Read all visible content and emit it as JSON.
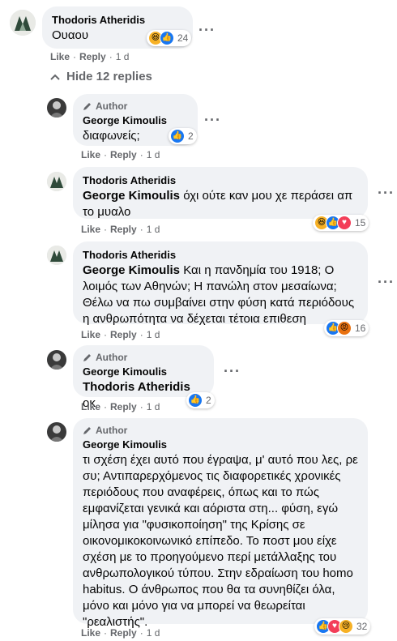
{
  "top_comment": {
    "author": "Thodoris Atheridis",
    "text": "Ουαου",
    "reactions": {
      "icons": [
        "haha",
        "like"
      ],
      "count": "24"
    },
    "actions": {
      "like": "Like",
      "reply": "Reply",
      "time": "1 d"
    }
  },
  "hide_replies": "Hide 12 replies",
  "author_badge": "Author",
  "replies": [
    {
      "author": "George Kimoulis",
      "is_author": true,
      "mention": "",
      "text": "διαφωνείς;",
      "reactions": {
        "icons": [
          "like"
        ],
        "count": "2"
      },
      "actions": {
        "like": "Like",
        "reply": "Reply",
        "time": "1 d"
      }
    },
    {
      "author": "Thodoris Atheridis",
      "is_author": false,
      "mention": "George Kimoulis",
      "text": " όχι ούτε καν μου χε περάσει απ το μυαλο",
      "reactions": {
        "icons": [
          "haha",
          "like",
          "love"
        ],
        "count": "15"
      },
      "actions": {
        "like": "Like",
        "reply": "Reply",
        "time": "1 d"
      }
    },
    {
      "author": "Thodoris Atheridis",
      "is_author": false,
      "mention": "George Kimoulis",
      "text": " Και η πανδημία του 1918; Ο λοιμός των Αθηνών; Η πανώλη στον μεσαίωνα; Θέλω να πω συμβαίνει στην φύση κατά περιόδους η ανθρωπότητα να δέχεται τέτοια επιθεση",
      "reactions": {
        "icons": [
          "like",
          "angry"
        ],
        "count": "16"
      },
      "actions": {
        "like": "Like",
        "reply": "Reply",
        "time": "1 d"
      }
    },
    {
      "author": "George Kimoulis",
      "is_author": true,
      "mention": "Thodoris Atheridis",
      "text": " οκ",
      "reactions": {
        "icons": [
          "like"
        ],
        "count": "2"
      },
      "actions": {
        "like": "Like",
        "reply": "Reply",
        "time": "1 d"
      }
    },
    {
      "author": "George Kimoulis",
      "is_author": true,
      "mention": "",
      "text": "τι σχέση έχει αυτό που έγραψα, μ' αυτό που λες, ρε συ; Αντιπαρερχόμενος τις διαφορετικές χρονικές περιόδους που αναφέρεις, όπως και το πώς εμφανίζεται γενικά και αόριστα στη... φύση, εγώ μίλησα για \"φυσικοποίηση\" της Κρίσης σε οικονομικοκοινωνικό επίπεδο. Το ποστ μου είχε σχέση με το προηγούμενο περί μετάλλαξης του ανθρωπολογικού τύπου. Στην εδραίωση του homo habitus. Ο άνθρωπος που θα τα συνηθίζει όλα, μόνο και μόνο για να μπορεί να θεωρείται \"ρεαλιστής\".",
      "reactions": {
        "icons": [
          "like",
          "love",
          "sad"
        ],
        "count": "32"
      },
      "actions": {
        "like": "Like",
        "reply": "Reply",
        "time": "1 d"
      }
    }
  ],
  "colors": {
    "like": "#1877f2",
    "love": "#f33e58",
    "haha": "#f7b125",
    "angry": "#e9710f",
    "sad": "#f7b125",
    "bubble": "#f0f2f5",
    "secondary_text": "#65676b"
  }
}
